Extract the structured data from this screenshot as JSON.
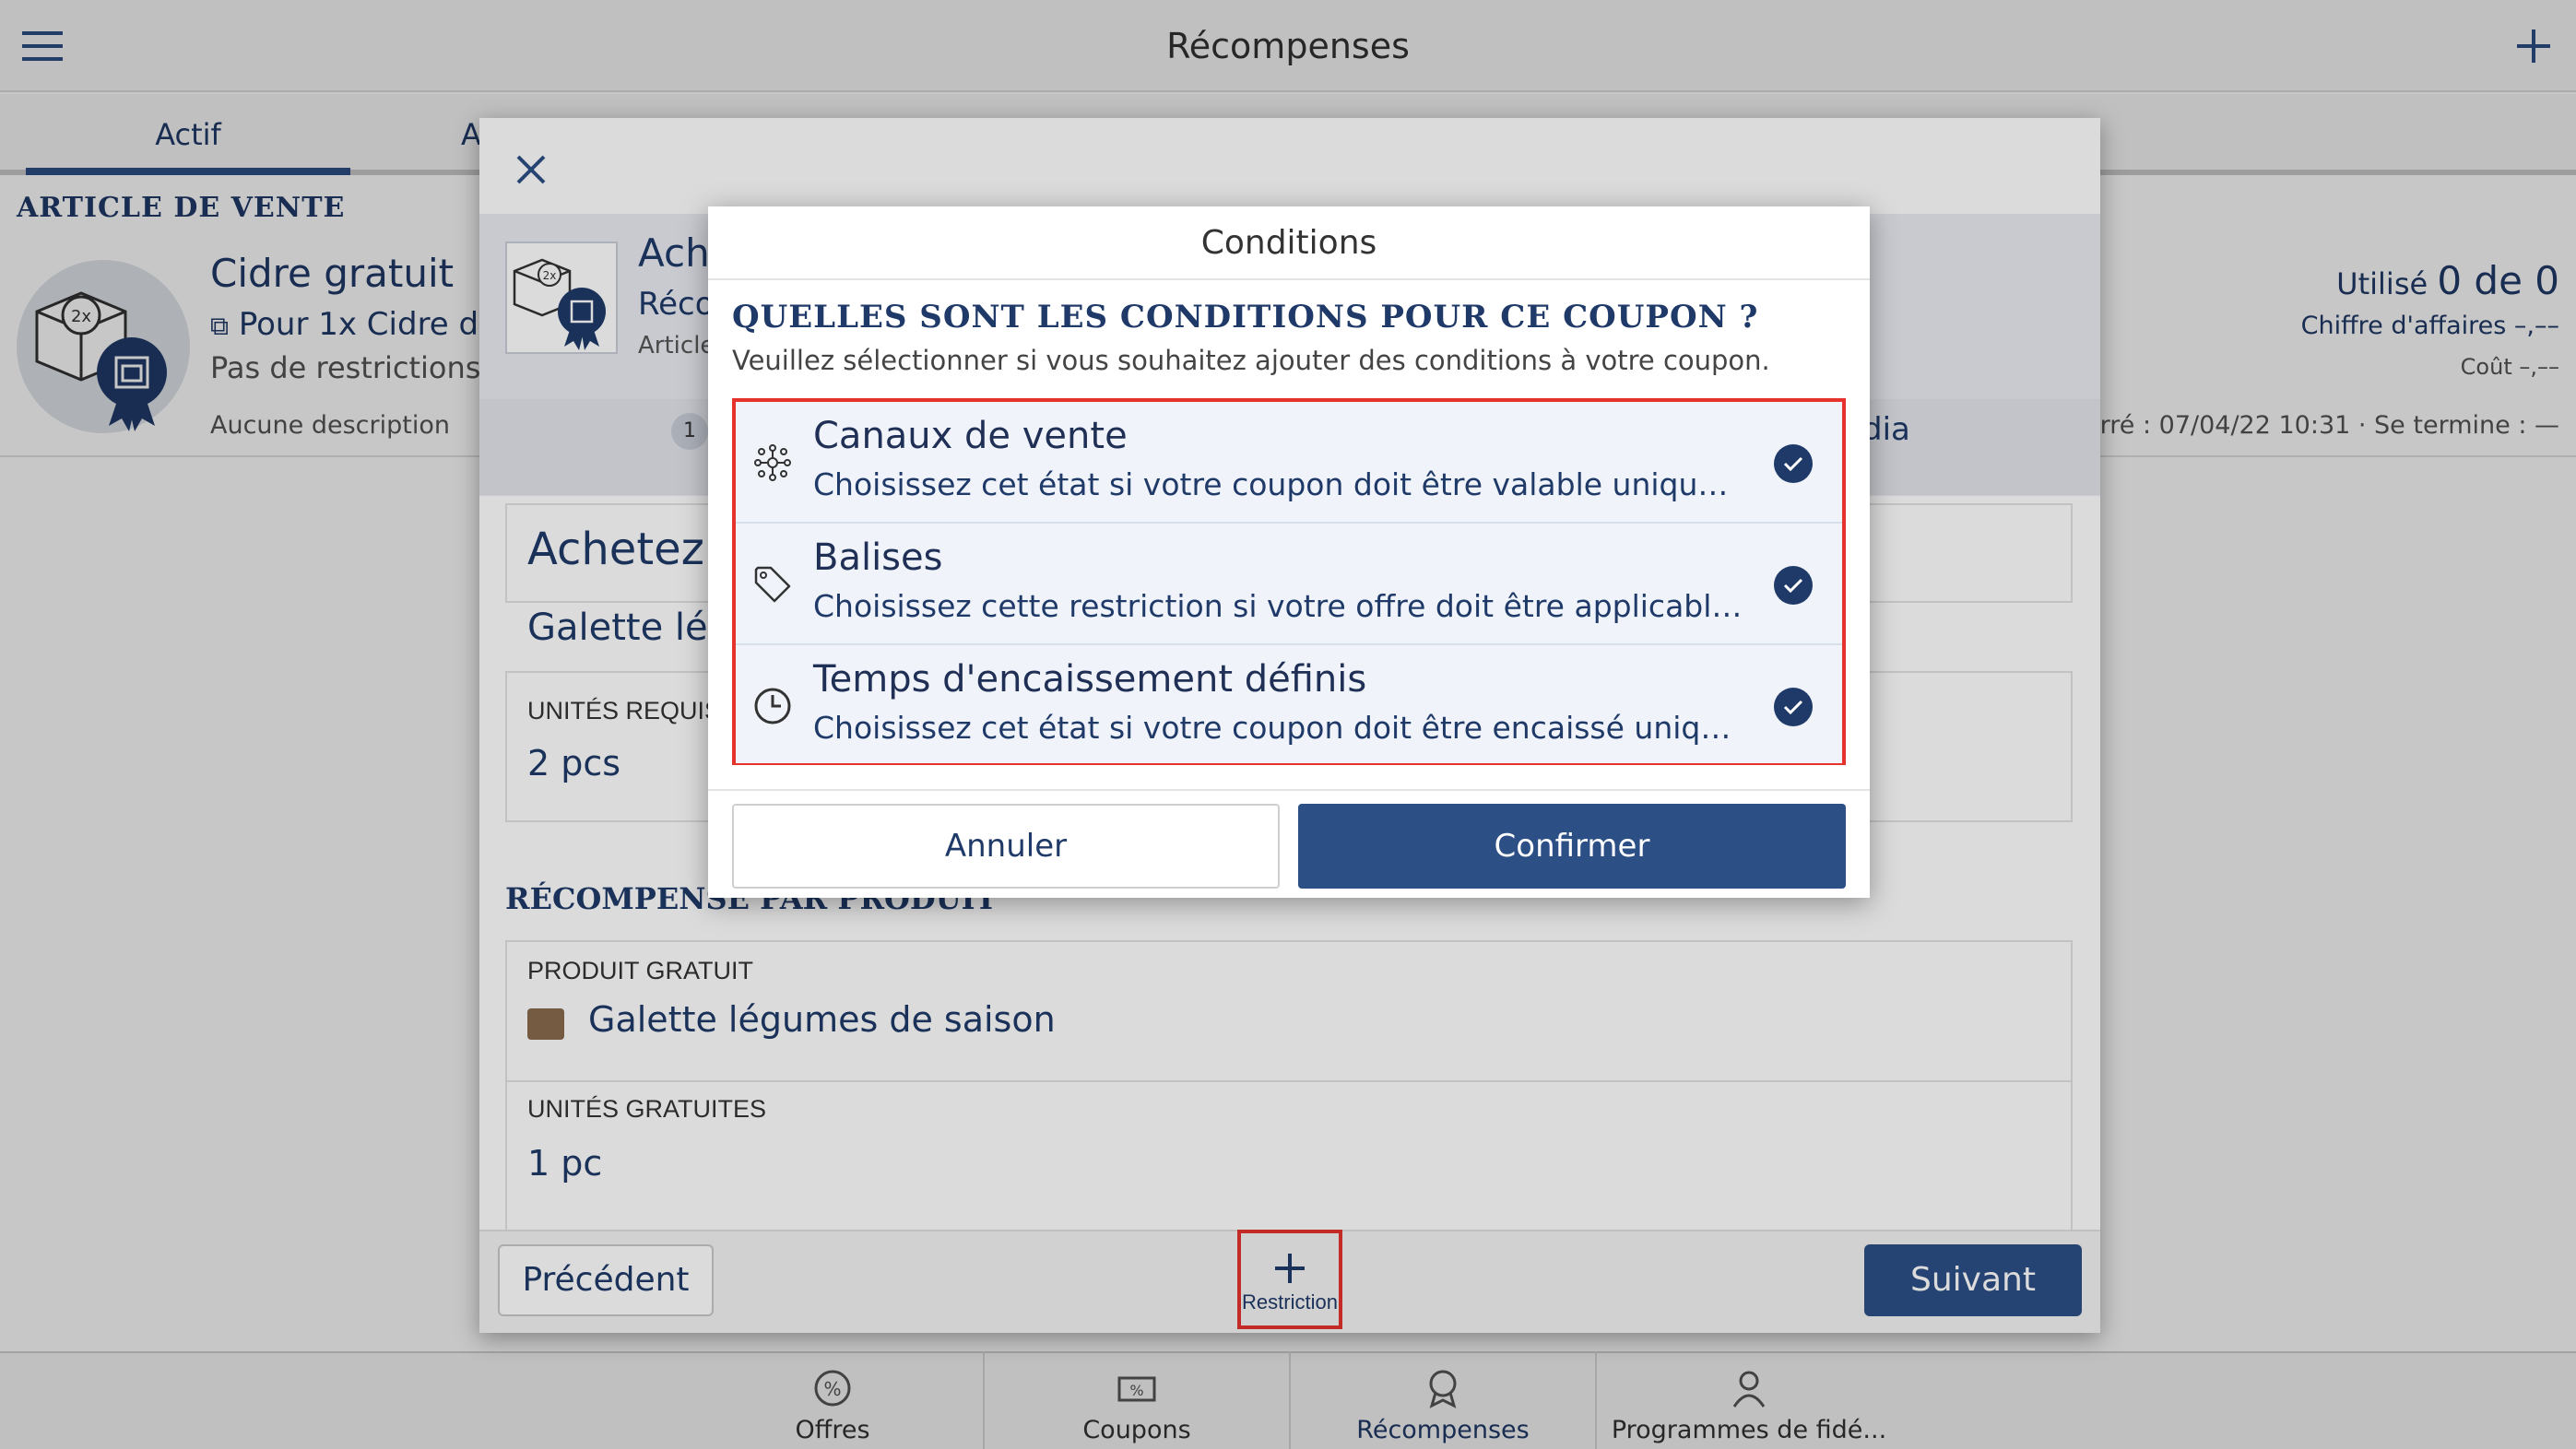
{
  "topbar": {
    "title": "Récompenses"
  },
  "tabs": {
    "active": "Actif",
    "second": "A"
  },
  "list": {
    "section": "ARTICLE DE VENTE",
    "item": {
      "title": "Cidre gratuit",
      "subtitle": "Pour 1x Cidre dou",
      "restrictions": "Pas de restrictions",
      "description": "Aucune description",
      "used_label": "Utilisé",
      "used_value": "0 de 0",
      "revenue": "Chiffre d'affaires –,––",
      "cost": "Coût –,––",
      "dates": "Démarré : 07/04/22 10:31 · Se termine : —"
    }
  },
  "sheet": {
    "title": "Ache",
    "subtitle": "Réco",
    "kind": "Article",
    "step_number": "1",
    "step_label": "dia",
    "big_title": "Achetez 2",
    "product_partial": "Galette lég",
    "units_label": "UNITÉS REQUISE",
    "units_value": "2 pcs",
    "reward_section": "RÉCOMPENSE PAR PRODUIT",
    "free_product_label": "PRODUIT GRATUIT",
    "free_product_value": "Galette légumes de saison",
    "free_units_label": "UNITÉS GRATUITES",
    "free_units_value": "1 pc",
    "prev_label": "Précédent",
    "restriction_label": "Restriction",
    "next_label": "Suivant"
  },
  "dialog": {
    "title": "Conditions",
    "question": "QUELLES SONT LES CONDITIONS POUR CE COUPON ?",
    "hint": "Veuillez sélectionner si vous souhaitez ajouter des conditions à votre coupon.",
    "options": [
      {
        "title": "Canaux de vente",
        "desc": "Choisissez cet état si votre coupon doit être valable uniquement p...",
        "icon": "sales-channels-icon",
        "checked": true
      },
      {
        "title": "Balises",
        "desc": "Choisissez cette restriction si votre offre doit être applicable uniqu...",
        "icon": "tag-icon",
        "checked": true
      },
      {
        "title": "Temps d'encaissement définis",
        "desc": "Choisissez cet état si votre coupon doit être encaissé uniquement ...",
        "icon": "clock-icon",
        "checked": true
      }
    ],
    "cancel_label": "Annuler",
    "confirm_label": "Confirmer"
  },
  "bottomnav": {
    "items": [
      {
        "label": "Offres"
      },
      {
        "label": "Coupons"
      },
      {
        "label": "Récompenses"
      },
      {
        "label": "Programmes de fidé..."
      }
    ]
  },
  "colors": {
    "accent": "#2c4f86",
    "highlight": "#e5322d",
    "text": "#1f3a68"
  }
}
